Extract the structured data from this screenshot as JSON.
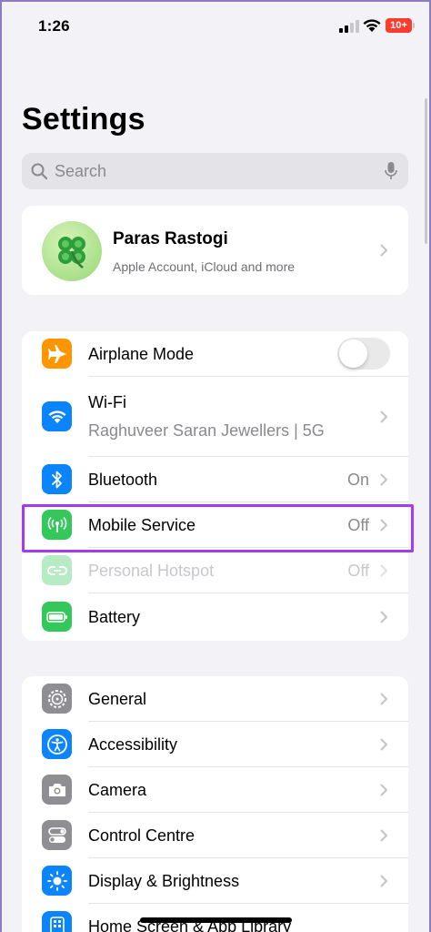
{
  "status_bar": {
    "time": "1:26",
    "battery": "10+"
  },
  "page_title": "Settings",
  "search": {
    "placeholder": "Search"
  },
  "account": {
    "name": "Paras Rastogi",
    "subtitle": "Apple Account, iCloud and more"
  },
  "connectivity": [
    {
      "label": "Airplane Mode",
      "type": "toggle",
      "toggle_on": false,
      "icon": "airplane-icon",
      "color": "#FF9500"
    },
    {
      "label": "Wi-Fi",
      "value": "Raghuveer Saran Jewellers | 5G",
      "icon": "wifi-icon",
      "color": "#0A84FF"
    },
    {
      "label": "Bluetooth",
      "value": "On",
      "icon": "bluetooth-icon",
      "color": "#0A84FF"
    },
    {
      "label": "Mobile Service",
      "value": "Off",
      "icon": "antenna-icon",
      "color": "#34C759",
      "highlighted": true
    },
    {
      "label": "Personal Hotspot",
      "value": "Off",
      "icon": "hotspot-icon",
      "color": "#34C759",
      "disabled": true
    },
    {
      "label": "Battery",
      "icon": "battery-icon",
      "color": "#34C759"
    }
  ],
  "general": [
    {
      "label": "General",
      "icon": "gear-icon",
      "color": "#8E8E93"
    },
    {
      "label": "Accessibility",
      "icon": "accessibility-icon",
      "color": "#0A84FF"
    },
    {
      "label": "Camera",
      "icon": "camera-icon",
      "color": "#8E8E93"
    },
    {
      "label": "Control Centre",
      "icon": "switches-icon",
      "color": "#8E8E93"
    },
    {
      "label": "Display & Brightness",
      "icon": "sun-icon",
      "color": "#0A84FF"
    },
    {
      "label": "Home Screen & App Library",
      "icon": "home-screen-icon",
      "color": "#0A84FF"
    }
  ]
}
